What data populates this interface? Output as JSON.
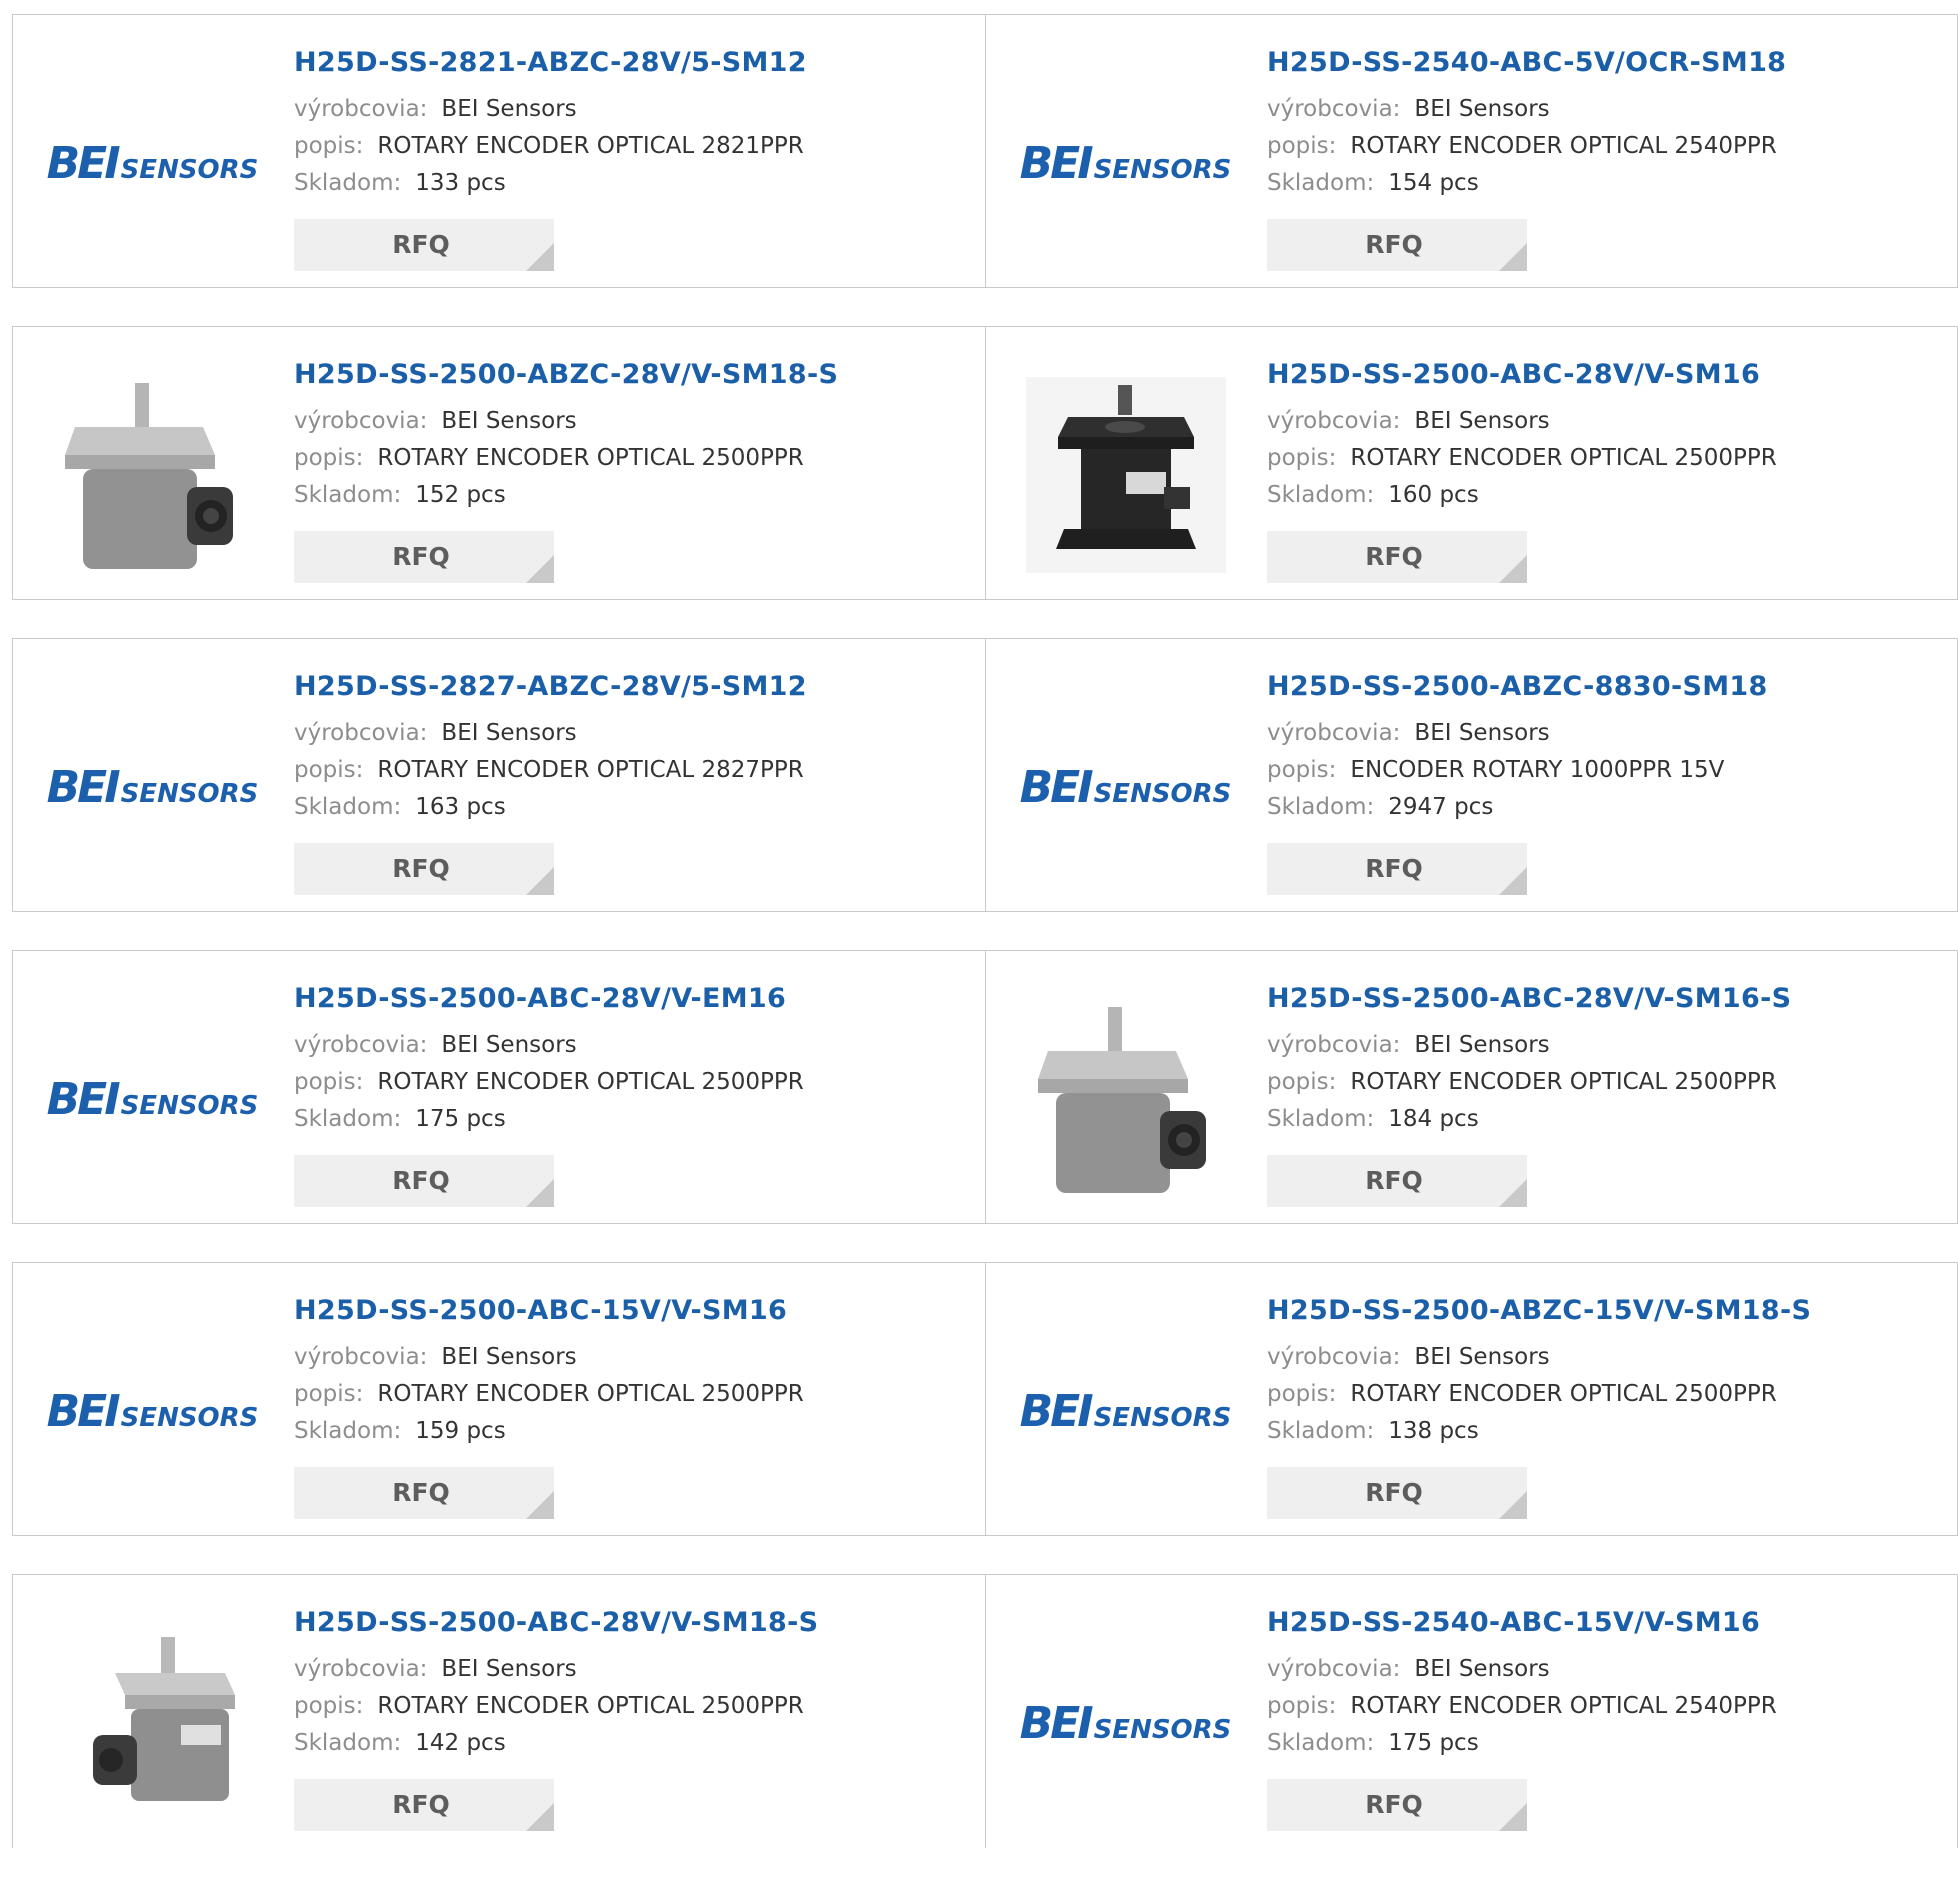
{
  "labels": {
    "manufacturer": "výrobcovia:",
    "description": "popis:",
    "stock": "Skladom:",
    "rfq": "RFQ"
  },
  "colors": {
    "part_number_link": "#1a5fa8",
    "label_gray": "#8d8d8d",
    "value_text": "#333333",
    "rfq_background": "#efefef",
    "border": "#c9c9c9",
    "logo_blue": "#1b5fad"
  },
  "products": [
    {
      "part": "H25D-SS-2821-ABZC-28V/5-SM12",
      "manufacturer": "BEI Sensors",
      "description": "ROTARY ENCODER OPTICAL 2821PPR",
      "stock": "133 pcs",
      "image": "bei-sensors-logo",
      "logo_text_1": "BEI",
      "logo_text_2": "SENSORS"
    },
    {
      "part": "H25D-SS-2540-ABC-5V/OCR-SM18",
      "manufacturer": "BEI Sensors",
      "description": "ROTARY ENCODER OPTICAL 2540PPR",
      "stock": "154 pcs",
      "image": "bei-sensors-logo",
      "logo_text_1": "BEI",
      "logo_text_2": "SENSORS"
    },
    {
      "part": "H25D-SS-2500-ABZC-28V/V-SM18-S",
      "manufacturer": "BEI Sensors",
      "description": "ROTARY ENCODER OPTICAL 2500PPR",
      "stock": "152 pcs",
      "image": "encoder-side-connector-photo"
    },
    {
      "part": "H25D-SS-2500-ABC-28V/V-SM16",
      "manufacturer": "BEI Sensors",
      "description": "ROTARY ENCODER OPTICAL 2500PPR",
      "stock": "160 pcs",
      "image": "encoder-black-flange-photo"
    },
    {
      "part": "H25D-SS-2827-ABZC-28V/5-SM12",
      "manufacturer": "BEI Sensors",
      "description": "ROTARY ENCODER OPTICAL 2827PPR",
      "stock": "163 pcs",
      "image": "bei-sensors-logo",
      "logo_text_1": "BEI",
      "logo_text_2": "SENSORS"
    },
    {
      "part": "H25D-SS-2500-ABZC-8830-SM18",
      "manufacturer": "BEI Sensors",
      "description": "ENCODER ROTARY 1000PPR 15V",
      "stock": "2947 pcs",
      "image": "bei-sensors-logo",
      "logo_text_1": "BEI",
      "logo_text_2": "SENSORS"
    },
    {
      "part": "H25D-SS-2500-ABC-28V/V-EM16",
      "manufacturer": "BEI Sensors",
      "description": "ROTARY ENCODER OPTICAL 2500PPR",
      "stock": "175 pcs",
      "image": "bei-sensors-logo",
      "logo_text_1": "BEI",
      "logo_text_2": "SENSORS"
    },
    {
      "part": "H25D-SS-2500-ABC-28V/V-SM16-S",
      "manufacturer": "BEI Sensors",
      "description": "ROTARY ENCODER OPTICAL 2500PPR",
      "stock": "184 pcs",
      "image": "encoder-side-connector-photo"
    },
    {
      "part": "H25D-SS-2500-ABC-15V/V-SM16",
      "manufacturer": "BEI Sensors",
      "description": "ROTARY ENCODER OPTICAL 2500PPR",
      "stock": "159 pcs",
      "image": "bei-sensors-logo",
      "logo_text_1": "BEI",
      "logo_text_2": "SENSORS"
    },
    {
      "part": "H25D-SS-2500-ABZC-15V/V-SM18-S",
      "manufacturer": "BEI Sensors",
      "description": "ROTARY ENCODER OPTICAL 2500PPR",
      "stock": "138 pcs",
      "image": "bei-sensors-logo",
      "logo_text_1": "BEI",
      "logo_text_2": "SENSORS"
    },
    {
      "part": "H25D-SS-2500-ABC-28V/V-SM18-S",
      "manufacturer": "BEI Sensors",
      "description": "ROTARY ENCODER OPTICAL 2500PPR",
      "stock": "142 pcs",
      "image": "encoder-left-connector-photo"
    },
    {
      "part": "H25D-SS-2540-ABC-15V/V-SM16",
      "manufacturer": "BEI Sensors",
      "description": "ROTARY ENCODER OPTICAL 2540PPR",
      "stock": "175 pcs",
      "image": "bei-sensors-logo",
      "logo_text_1": "BEI",
      "logo_text_2": "SENSORS"
    }
  ]
}
